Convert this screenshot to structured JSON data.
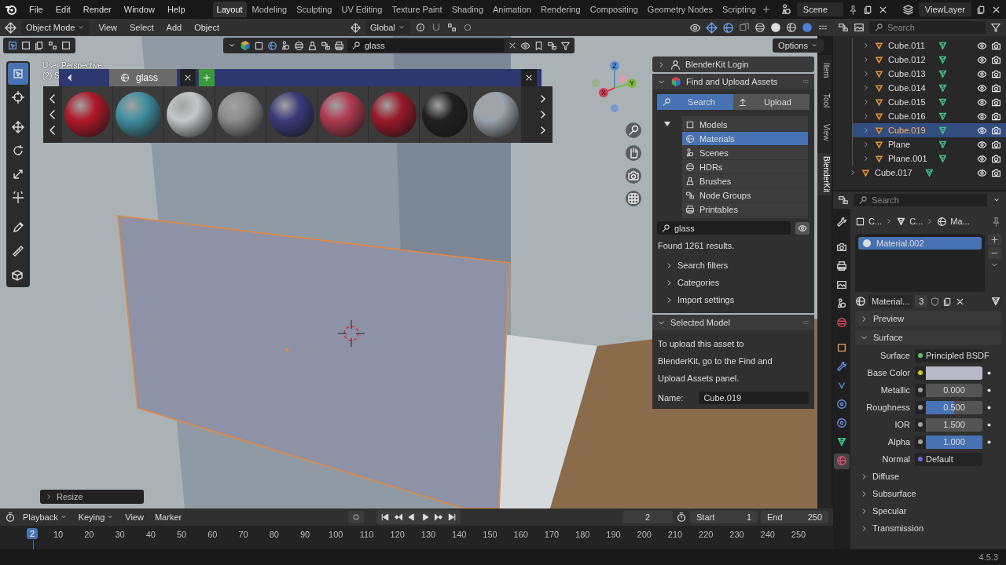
{
  "menubar": {
    "menus": [
      "File",
      "Edit",
      "Render",
      "Window",
      "Help"
    ],
    "workspaces": [
      {
        "label": "Layout",
        "selected": true
      },
      {
        "label": "Modeling",
        "selected": false
      },
      {
        "label": "Sculpting",
        "selected": false
      },
      {
        "label": "UV Editing",
        "selected": false
      },
      {
        "label": "Texture Paint",
        "selected": false
      },
      {
        "label": "Shading",
        "selected": false
      },
      {
        "label": "Animation",
        "selected": false
      },
      {
        "label": "Rendering",
        "selected": false
      },
      {
        "label": "Compositing",
        "selected": false
      },
      {
        "label": "Geometry Nodes",
        "selected": false
      },
      {
        "label": "Scripting",
        "selected": false
      }
    ],
    "scene": "Scene",
    "view_layer": "ViewLayer"
  },
  "viewport": {
    "mode": "Object Mode",
    "menus": [
      "View",
      "Select",
      "Add",
      "Object"
    ],
    "orientation": "Global",
    "blenderkit_bar": {
      "search": "glass"
    },
    "options": "Options",
    "overlay_text": [
      "User Perspective",
      "(2) S"
    ],
    "tools": [
      {
        "kind": "select",
        "selected": true
      },
      {
        "kind": "cursor",
        "selected": false
      },
      {
        "kind": "move",
        "selected": false
      },
      {
        "kind": "rotate",
        "selected": false
      },
      {
        "kind": "scale",
        "selected": false
      },
      {
        "kind": "transform",
        "selected": false
      },
      {
        "kind": "annotate",
        "selected": false
      },
      {
        "kind": "measure",
        "selected": false
      },
      {
        "kind": "add-cube",
        "selected": false
      }
    ],
    "asset_bar": {
      "tab": "glass",
      "thumbnails": [
        {
          "color": "#b01828"
        },
        {
          "color": "#3f8ea0"
        },
        {
          "color": "#c4c8c8"
        },
        {
          "color": "#8c8c8c"
        },
        {
          "color": "#3a3a7a"
        },
        {
          "color": "#b03a50"
        },
        {
          "color": "#9a1828"
        },
        {
          "color": "#202020"
        },
        {
          "color": "#9aa4ac"
        }
      ]
    },
    "gizmo_axes": [
      "Z",
      "Y",
      "X"
    ],
    "sidebar_tabs": [
      {
        "label": "Item",
        "selected": false
      },
      {
        "label": "Tool",
        "selected": false
      },
      {
        "label": "View",
        "selected": false
      },
      {
        "label": "BlenderKit",
        "selected": true
      }
    ],
    "last_operator": "Resize"
  },
  "blenderkit_panel": {
    "login": {
      "title": "BlenderKit Login",
      "expanded": false
    },
    "find": {
      "title": "Find and Upload Assets",
      "expanded": true,
      "tabs": [
        {
          "label": "Search",
          "selected": true
        },
        {
          "label": "Upload",
          "selected": false
        }
      ],
      "types_expanded": true,
      "asset_types": [
        {
          "label": "Models",
          "kind": "model",
          "selected": false
        },
        {
          "label": "Materials",
          "kind": "material",
          "selected": true
        },
        {
          "label": "Scenes",
          "kind": "scene",
          "selected": false
        },
        {
          "label": "HDRs",
          "kind": "hdr",
          "selected": false
        },
        {
          "label": "Brushes",
          "kind": "brush",
          "selected": false
        },
        {
          "label": "Node Groups",
          "kind": "nodes",
          "selected": false
        },
        {
          "label": "Printables",
          "kind": "printable",
          "selected": false
        }
      ],
      "search": "glass",
      "results": "Found 1261 results.",
      "subsections": [
        {
          "title": "Search filters",
          "expanded": false
        },
        {
          "title": "Categories",
          "expanded": false
        },
        {
          "title": "Import settings",
          "expanded": false
        }
      ]
    },
    "selected_model": {
      "title": "Selected Model",
      "expanded": true,
      "text": "To upload this asset to BlenderKit, go to the Find and Upload Assets panel.",
      "name_label": "Name:",
      "name": "Cube.019"
    }
  },
  "timeline": {
    "menus": [
      "Playback",
      "Keying",
      "View",
      "Marker"
    ],
    "current_frame": "2",
    "start_label": "Start",
    "start": "1",
    "end_label": "End",
    "end": "250",
    "playhead": "2",
    "ticks": [
      "10",
      "20",
      "30",
      "40",
      "50",
      "60",
      "70",
      "80",
      "90",
      "100",
      "110",
      "120",
      "130",
      "140",
      "150",
      "160",
      "170",
      "180",
      "190",
      "200",
      "210",
      "220",
      "230",
      "240",
      "250"
    ]
  },
  "outliner": {
    "search_placeholder": "Search",
    "rows": [
      {
        "children": [
          {
            "name": "Cube.011",
            "selected": false,
            "expanded": false
          },
          {
            "name": "Cube.012",
            "selected": false,
            "expanded": false
          },
          {
            "name": "Cube.013",
            "selected": false,
            "expanded": false
          },
          {
            "name": "Cube.014",
            "selected": false,
            "expanded": false
          },
          {
            "name": "Cube.015",
            "selected": false,
            "expanded": false
          },
          {
            "name": "Cube.016",
            "selected": false,
            "expanded": false
          },
          {
            "name": "Cube.019",
            "selected": true,
            "expanded": false
          },
          {
            "name": "Plane",
            "selected": false,
            "expanded": false
          },
          {
            "name": "Plane.001",
            "selected": false,
            "expanded": false
          }
        ]
      },
      {
        "name": "Cube.017",
        "selected": false,
        "expanded": false
      }
    ]
  },
  "properties": {
    "search_placeholder": "Search",
    "breadcrumbs": [
      "C...",
      "C...",
      "Ma..."
    ],
    "tabs": [
      {
        "kind": "tool",
        "selected": false
      },
      {
        "kind": "render",
        "selected": false
      },
      {
        "kind": "output",
        "selected": false
      },
      {
        "kind": "view-layer",
        "selected": false
      },
      {
        "kind": "scene",
        "selected": false
      },
      {
        "kind": "world",
        "selected": false
      },
      {
        "kind": "object",
        "selected": false
      },
      {
        "kind": "modifier",
        "selected": false
      },
      {
        "kind": "particles",
        "selected": false
      },
      {
        "kind": "physics",
        "selected": false
      },
      {
        "kind": "constraints",
        "selected": false
      },
      {
        "kind": "data",
        "selected": false
      },
      {
        "kind": "material",
        "selected": true
      }
    ],
    "material_slots": [
      {
        "name": "Material.002",
        "selected": true
      }
    ],
    "datablock": "Material...",
    "users": "3",
    "panels": [
      {
        "title": "Preview",
        "expanded": false
      },
      {
        "title": "Surface",
        "expanded": true
      }
    ],
    "surface": [
      {
        "label": "Surface",
        "kind": "shader",
        "value": "Principled BSDF",
        "color": "#5fc35f"
      },
      {
        "label": "Base Color",
        "kind": "color",
        "color": "#c8c82a"
      },
      {
        "label": "Metallic",
        "kind": "slider",
        "value": "0.000",
        "level": 0,
        "color": "#a0a0a0"
      },
      {
        "label": "Roughness",
        "kind": "slider",
        "value": "0.500",
        "level": 0.5,
        "color": "#a0a0a0"
      },
      {
        "label": "IOR",
        "kind": "number",
        "value": "1.500",
        "color": "#a0a0a0"
      },
      {
        "label": "Alpha",
        "kind": "slider",
        "value": "1.000",
        "level": 1,
        "color": "#a0a0a0"
      },
      {
        "label": "Normal",
        "kind": "link",
        "value": "Default",
        "color": "#6a6ad0"
      }
    ],
    "subpanels": [
      {
        "title": "Diffuse",
        "expanded": false
      },
      {
        "title": "Subsurface",
        "expanded": false
      },
      {
        "title": "Specular",
        "expanded": false
      },
      {
        "title": "Transmission",
        "expanded": false
      }
    ]
  },
  "status_bar": {
    "version": "4.5.3"
  }
}
